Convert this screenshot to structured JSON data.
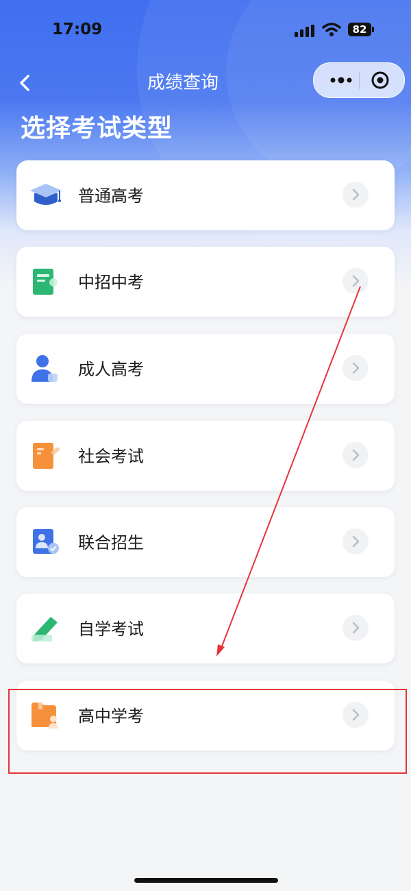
{
  "status_bar": {
    "time": "17:09",
    "battery": "82"
  },
  "nav": {
    "title": "成绩查询"
  },
  "page": {
    "heading": "选择考试类型"
  },
  "exam_types": [
    {
      "label": "普通高考",
      "icon": "graduation-cap-icon"
    },
    {
      "label": "中招中考",
      "icon": "green-book-icon"
    },
    {
      "label": "成人高考",
      "icon": "person-icon"
    },
    {
      "label": "社会考试",
      "icon": "orange-document-icon"
    },
    {
      "label": "联合招生",
      "icon": "id-card-check-icon"
    },
    {
      "label": "自学考试",
      "icon": "green-pencil-icon"
    },
    {
      "label": "高中学考",
      "icon": "orange-folder-person-icon"
    }
  ],
  "colors": {
    "header_blue": "#3f6ff0",
    "annotation_red": "#e5343a",
    "card_bg": "#ffffff",
    "page_bg": "#f4f5f7"
  }
}
